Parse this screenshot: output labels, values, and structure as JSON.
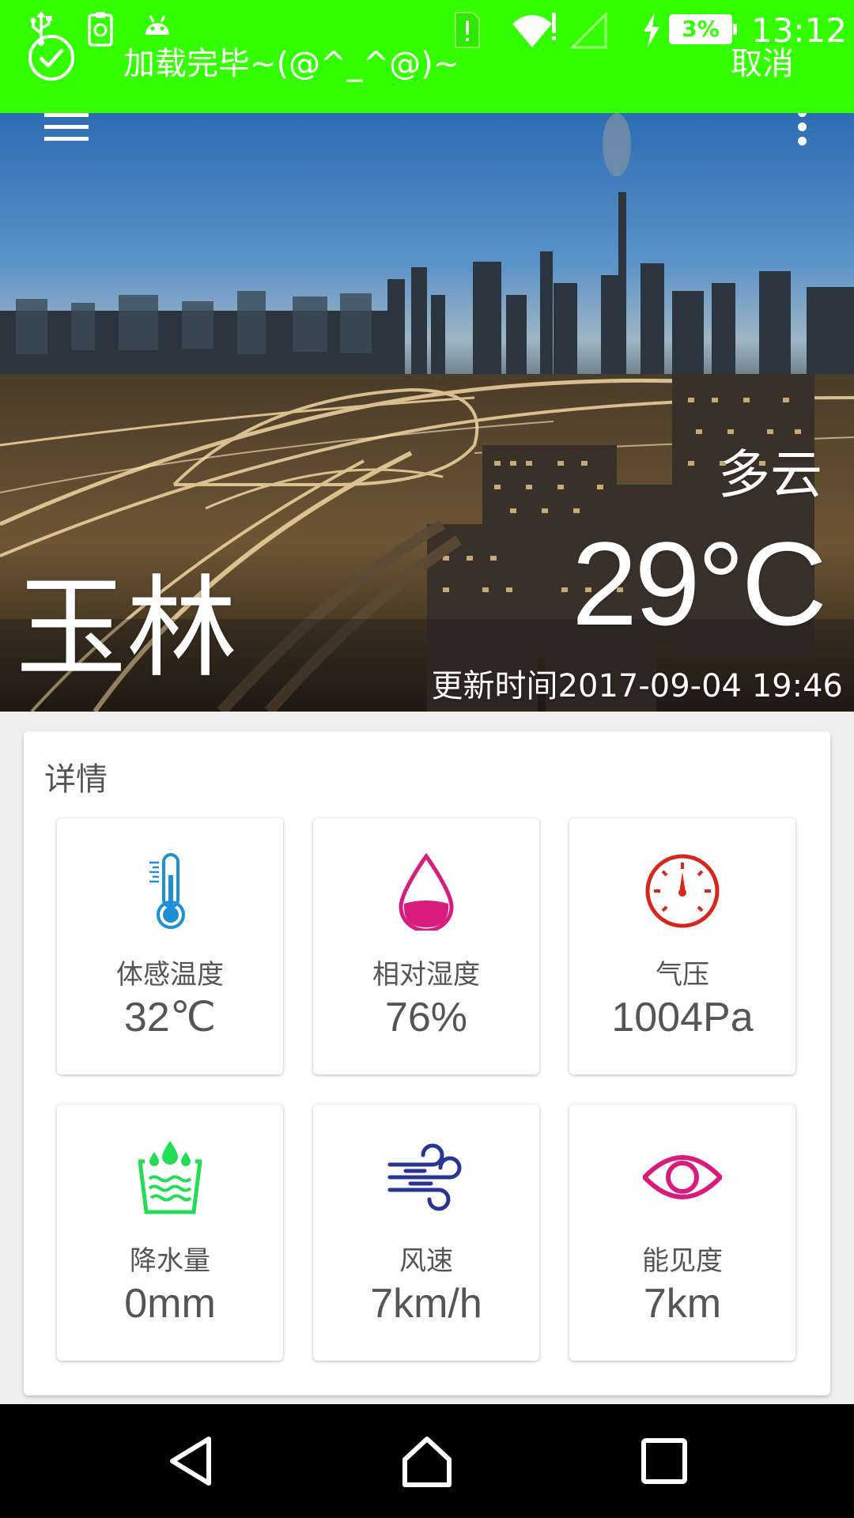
{
  "status_bar": {
    "toast_text": "加载完毕~(@^_^@)~",
    "cancel_label": "取消",
    "battery_percent": "3%",
    "time": "13:12",
    "icons": [
      "check-circle-icon",
      "usb-icon",
      "clipboard-icon",
      "android-icon",
      "sim-alert-icon",
      "wifi-icon",
      "signal-icon",
      "charging-icon",
      "battery-icon"
    ],
    "background_color": "#33ff00"
  },
  "header": {
    "menu_icon": "hamburger-menu-icon",
    "more_icon": "more-vert-icon",
    "weather_desc": "多云",
    "temperature": "29°C",
    "city": "玉林",
    "update_time": "更新时间2017-09-04 19:46"
  },
  "details": {
    "title": "详情",
    "items": [
      {
        "icon": "thermometer-icon",
        "label": "体感温度",
        "value": "32℃",
        "color": "#1e8fd6"
      },
      {
        "icon": "humidity-drop-icon",
        "label": "相对湿度",
        "value": "76%",
        "color": "#d81b7c"
      },
      {
        "icon": "pressure-gauge-icon",
        "label": "气压",
        "value": "1004Pa",
        "color": "#d9261c"
      },
      {
        "icon": "precipitation-icon",
        "label": "降水量",
        "value": "0mm",
        "color": "#22dd55"
      },
      {
        "icon": "wind-icon",
        "label": "风速",
        "value": "7km/h",
        "color": "#283593"
      },
      {
        "icon": "visibility-eye-icon",
        "label": "能见度",
        "value": "7km",
        "color": "#d81b7c"
      }
    ]
  },
  "nav_bar": {
    "icons": [
      "back-icon",
      "home-icon",
      "recent-apps-icon"
    ]
  }
}
